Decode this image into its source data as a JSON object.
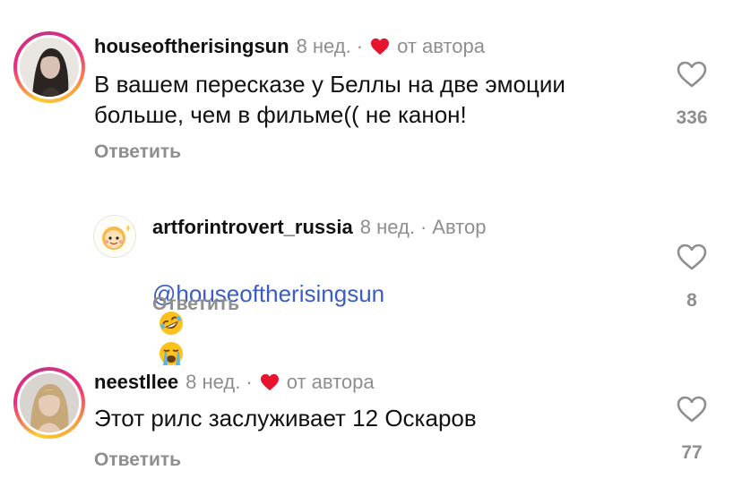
{
  "comments": [
    {
      "username": "houseoftherisingsun",
      "time": "8 нед.",
      "dot": "·",
      "author_badge": "от автора",
      "text": "В вашем пересказе у Беллы на две эмоции\nбольше, чем в фильме(( не канон!",
      "reply_label": "Ответить",
      "likes": "336",
      "heart_color": "#e8132c"
    },
    {
      "username": "artforintrovert_russia",
      "time": "8 нед.",
      "dot": "·",
      "author_badge": "Автор",
      "mention": "@houseoftherisingsun",
      "emojis": [
        "rolling-on-floor-laughing",
        "loudly-crying-face"
      ],
      "reply_label": "Ответить",
      "likes": "8"
    },
    {
      "username": "neestllee",
      "time": "8 нед.",
      "dot": "·",
      "author_badge": "от автора",
      "text": "Этот рилс заслуживает 12 Оскаров",
      "reply_label": "Ответить",
      "likes": "77",
      "heart_color": "#e8132c"
    }
  ],
  "colors": {
    "mention": "#3b5cc4",
    "muted": "#8e8e8e",
    "heart": "#e8132c"
  }
}
